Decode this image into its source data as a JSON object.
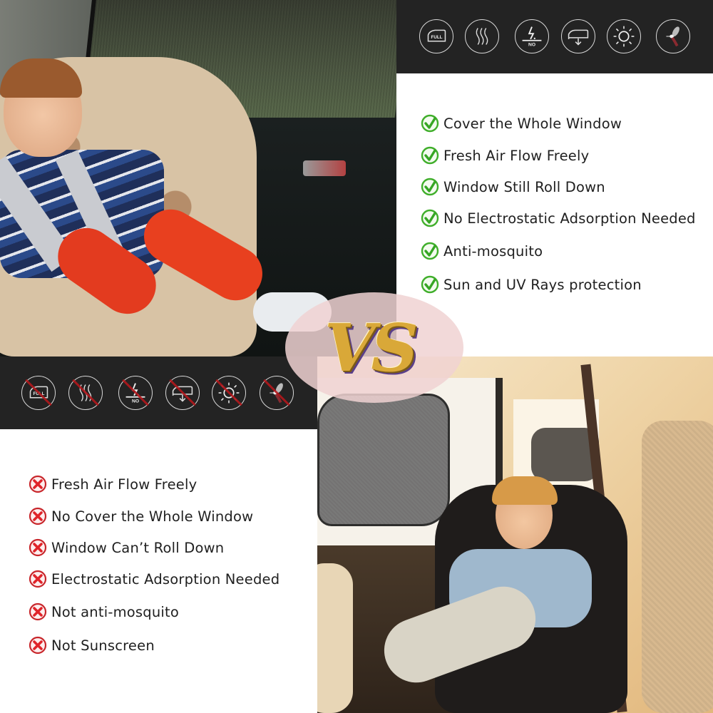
{
  "vs_label": "VS",
  "top_icons": [
    {
      "name": "full-window-icon",
      "label": "FULL"
    },
    {
      "name": "air-flow-icon",
      "label": ""
    },
    {
      "name": "no-static-icon",
      "label": "NO"
    },
    {
      "name": "window-roll-down-icon",
      "label": ""
    },
    {
      "name": "sun-icon",
      "label": ""
    },
    {
      "name": "mosquito-icon",
      "label": ""
    }
  ],
  "bottom_icons": [
    {
      "name": "full-window-crossed-icon",
      "label": "FULL"
    },
    {
      "name": "air-flow-crossed-icon",
      "label": ""
    },
    {
      "name": "no-static-crossed-icon",
      "label": "NO"
    },
    {
      "name": "window-roll-down-crossed-icon",
      "label": ""
    },
    {
      "name": "sun-crossed-icon",
      "label": ""
    },
    {
      "name": "mosquito-crossed-icon",
      "label": ""
    }
  ],
  "pros": [
    "Cover the Whole Window",
    "Fresh Air Flow Freely",
    "Window Still Roll Down",
    "No Electrostatic Adsorption Needed",
    "Anti-mosquito",
    "Sun and UV Rays protection"
  ],
  "cons": [
    "Fresh Air Flow Freely",
    "No Cover the Whole Window",
    "Window Can’t Roll Down",
    "Electrostatic Adsorption Needed",
    "Not anti-mosquito",
    "Not Sunscreen"
  ],
  "colors": {
    "check_green": "#3fae2a",
    "cross_red": "#d8262b",
    "band_dark": "#232323",
    "vs_gold": "#d9a838"
  }
}
